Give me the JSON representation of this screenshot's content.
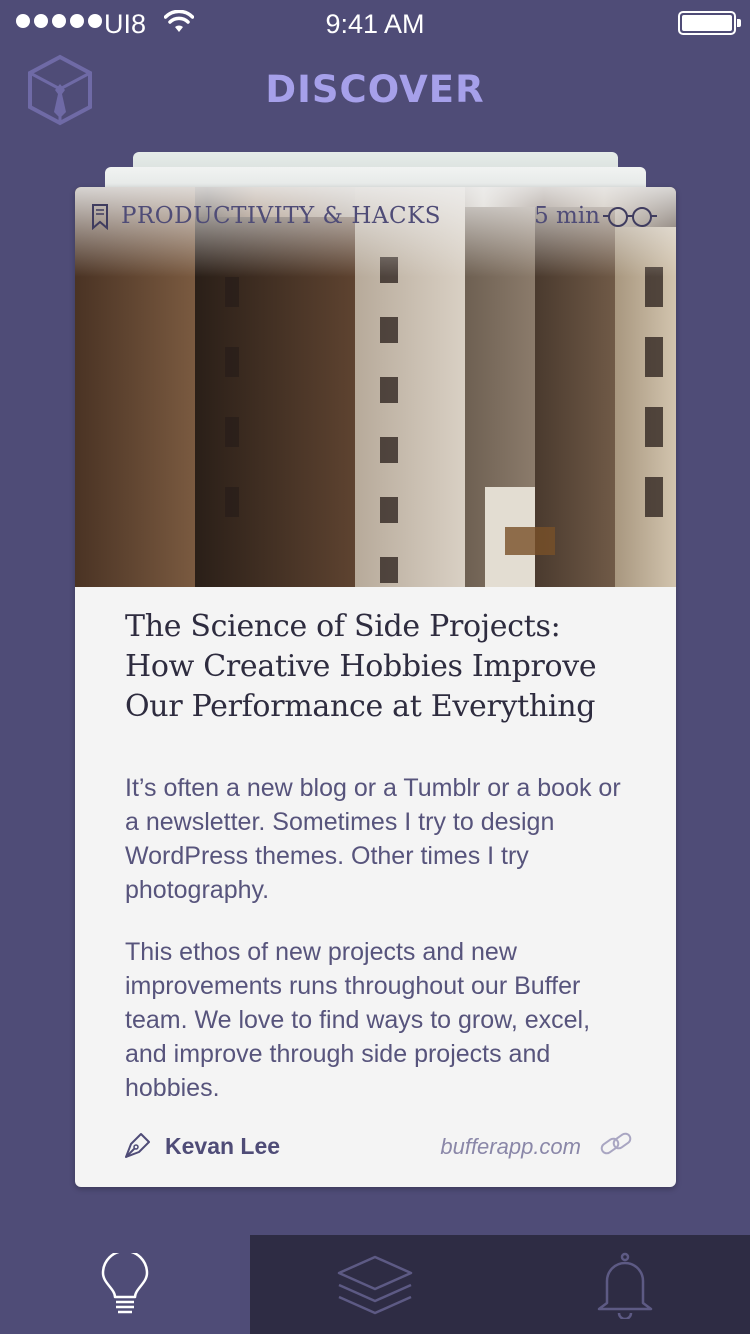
{
  "status_bar": {
    "carrier": "UI8",
    "time": "9:41 AM"
  },
  "header": {
    "title": "DISCOVER",
    "logo_icon": "cube-necktie-logo"
  },
  "card": {
    "category": "PRODUCTIVITY & HACKS",
    "read_time": "5 min",
    "headline": "The Science of Side Projects: How Creative Hobbies Improve Our Performance at Everything",
    "paragraphs": [
      "It’s often a new blog or a Tumblr or a book or a newsletter. Sometimes I try to design WordPress themes. Other times I try photography.",
      "This ethos of new projects and new improvements runs throughout our Buffer team. We love to find ways to grow, excel, and improve through side projects and hobbies."
    ],
    "author": "Kevan Lee",
    "source": "bufferapp.com"
  },
  "tab_bar": {
    "tabs": [
      {
        "icon": "lightbulb-icon",
        "active": true
      },
      {
        "icon": "layers-icon",
        "active": false
      },
      {
        "icon": "bell-icon",
        "active": false
      }
    ]
  },
  "colors": {
    "background": "#4f4c77",
    "accent_title": "#a6a0ea",
    "tab_inactive": "#2e2c44",
    "card": "#f4f4f4"
  }
}
